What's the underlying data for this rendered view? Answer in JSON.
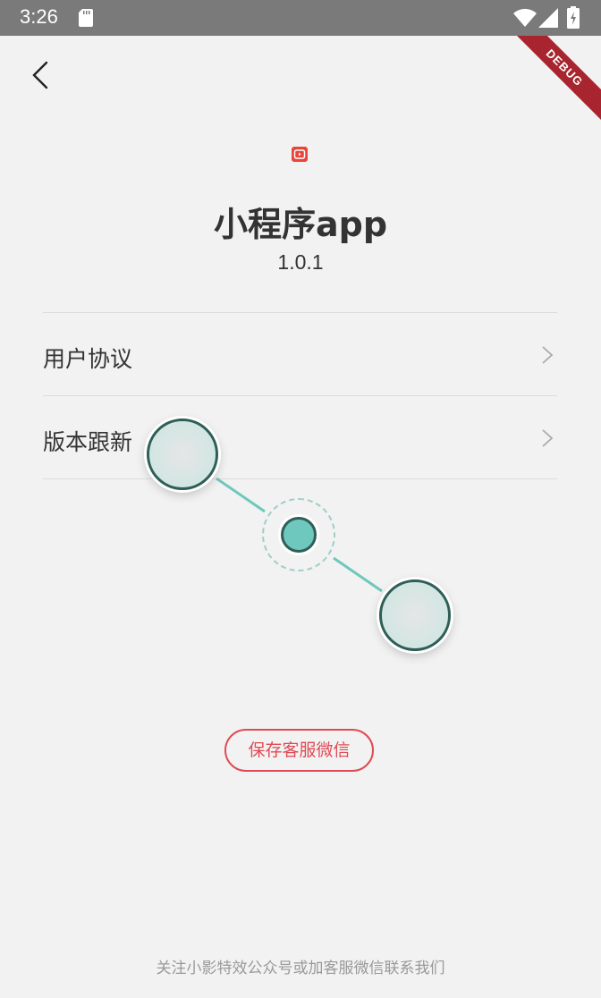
{
  "status_bar": {
    "time": "3:26",
    "icons": [
      "sd-card-icon",
      "wifi-icon",
      "cell-signal-icon",
      "battery-charging-icon"
    ]
  },
  "debug_banner": {
    "label": "DEBUG",
    "color": "#a8252f"
  },
  "nav": {
    "back_icon": "back-chevron-icon"
  },
  "app": {
    "icon": "app-logo-icon",
    "icon_color": "#e8463c",
    "name": "小程序app",
    "version": "1.0.1"
  },
  "menu": {
    "items": [
      {
        "label": "用户协议",
        "icon": "chevron-right-icon"
      },
      {
        "label": "版本跟新",
        "icon": "chevron-right-icon"
      }
    ]
  },
  "overlay": {
    "type": "drag-handles",
    "accent": "#6ec8bd",
    "border": "#2f5e57"
  },
  "actions": {
    "save_contact_label": "保存客服微信",
    "accent": "#e04a54"
  },
  "footer": {
    "text": "关注小影特效公众号或加客服微信联系我们"
  }
}
